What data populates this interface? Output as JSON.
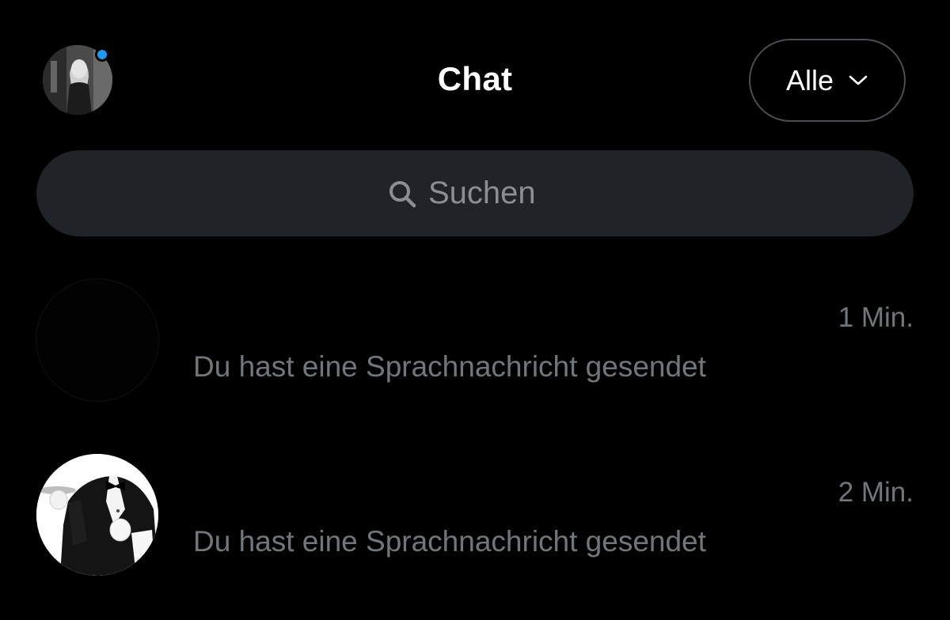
{
  "header": {
    "title": "Chat",
    "filter_label": "Alle",
    "online_color": "#1d9bf0"
  },
  "search": {
    "placeholder": "Suchen",
    "icon": "search-icon"
  },
  "conversations": [
    {
      "name": "",
      "preview": "Du hast eine Sprachnachricht gesendet",
      "time": "1 Min.",
      "avatar": "black-avatar"
    },
    {
      "name": "",
      "preview": "Du hast eine Sprachnachricht gesendet",
      "time": "2 Min.",
      "avatar": "butler-avatar"
    }
  ],
  "colors": {
    "background": "#000000",
    "search_bg": "#202327",
    "secondary_text": "#71767b",
    "accent": "#1d9bf0"
  }
}
